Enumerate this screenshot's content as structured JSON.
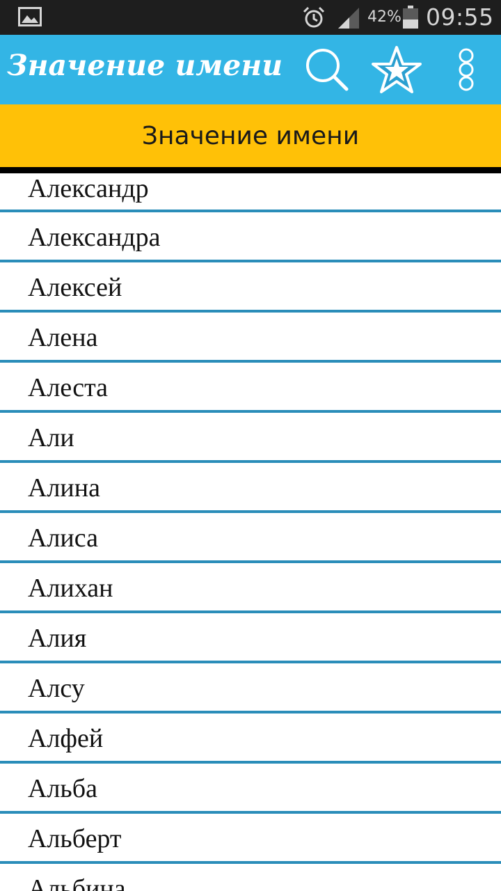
{
  "status_bar": {
    "battery_percent": "42%",
    "time": "09:55",
    "icons": [
      "gallery-icon",
      "alarm-icon",
      "signal-icon",
      "battery-icon"
    ],
    "battery_level": 0.42
  },
  "action_bar": {
    "title": "Значение имени",
    "actions": [
      "search-icon",
      "star-icon",
      "overflow-menu-icon"
    ],
    "background_color": "#33b5e5"
  },
  "section_header": {
    "label": "Значение имени",
    "background_color": "#ffc107"
  },
  "names": [
    "Александр",
    "Александра",
    "Алексей",
    "Алена",
    "Алеста",
    "Али",
    "Алина",
    "Алиса",
    "Алихан",
    "Алия",
    "Алсу",
    "Алфей",
    "Альба",
    "Альберт",
    "Альбина"
  ],
  "divider_color": "#2a8db9"
}
